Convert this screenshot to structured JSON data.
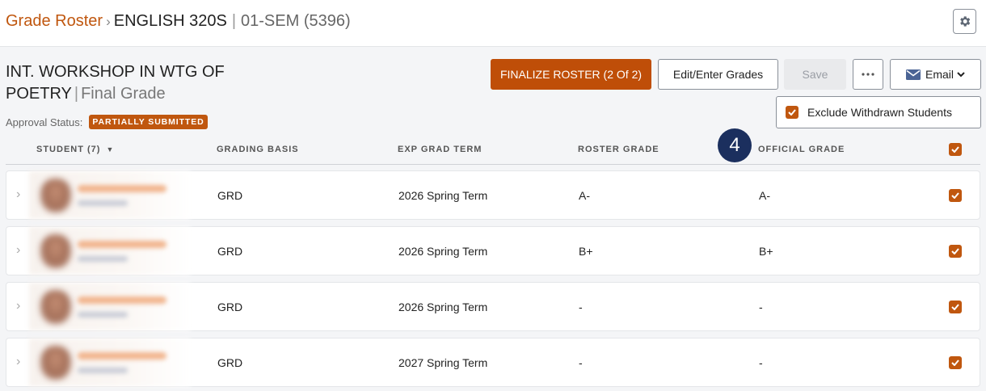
{
  "breadcrumb": {
    "root": "Grade Roster",
    "course": "ENGLISH 320S",
    "section": "01-SEM (5396)"
  },
  "heading": {
    "title": "INT. WORKSHOP IN WTG OF POETRY",
    "suffix": "Final Grade"
  },
  "approval": {
    "label": "Approval Status:",
    "status": "PARTIALLY SUBMITTED"
  },
  "toolbar": {
    "finalize": "FINALIZE ROSTER (2 Of 2)",
    "edit": "Edit/Enter Grades",
    "save": "Save",
    "email": "Email",
    "exclude_withdrawn": "Exclude Withdrawn Students"
  },
  "step_marker": "4",
  "table": {
    "headers": {
      "student": "STUDENT (7)",
      "grading_basis": "GRADING BASIS",
      "exp_grad_term": "EXP GRAD TERM",
      "roster_grade": "ROSTER GRADE",
      "official_grade": "OFFICIAL GRADE"
    },
    "rows": [
      {
        "grading_basis": "GRD",
        "exp_grad_term": "2026 Spring Term",
        "roster_grade": "A-",
        "official_grade": "A-"
      },
      {
        "grading_basis": "GRD",
        "exp_grad_term": "2026 Spring Term",
        "roster_grade": "B+",
        "official_grade": "B+"
      },
      {
        "grading_basis": "GRD",
        "exp_grad_term": "2026 Spring Term",
        "roster_grade": "-",
        "official_grade": "-"
      },
      {
        "grading_basis": "GRD",
        "exp_grad_term": "2027 Spring Term",
        "roster_grade": "-",
        "official_grade": "-"
      }
    ]
  },
  "colors": {
    "accent": "#c0570f",
    "finalize_button": "#bf4e08",
    "step_marker": "#1b2f5e"
  },
  "icons": {
    "settings": "gear-icon",
    "more": "more-options-icon",
    "email": "envelope-icon",
    "expand": "chevron-right-icon",
    "sort": "caret-down-icon",
    "check": "checkmark-icon"
  }
}
